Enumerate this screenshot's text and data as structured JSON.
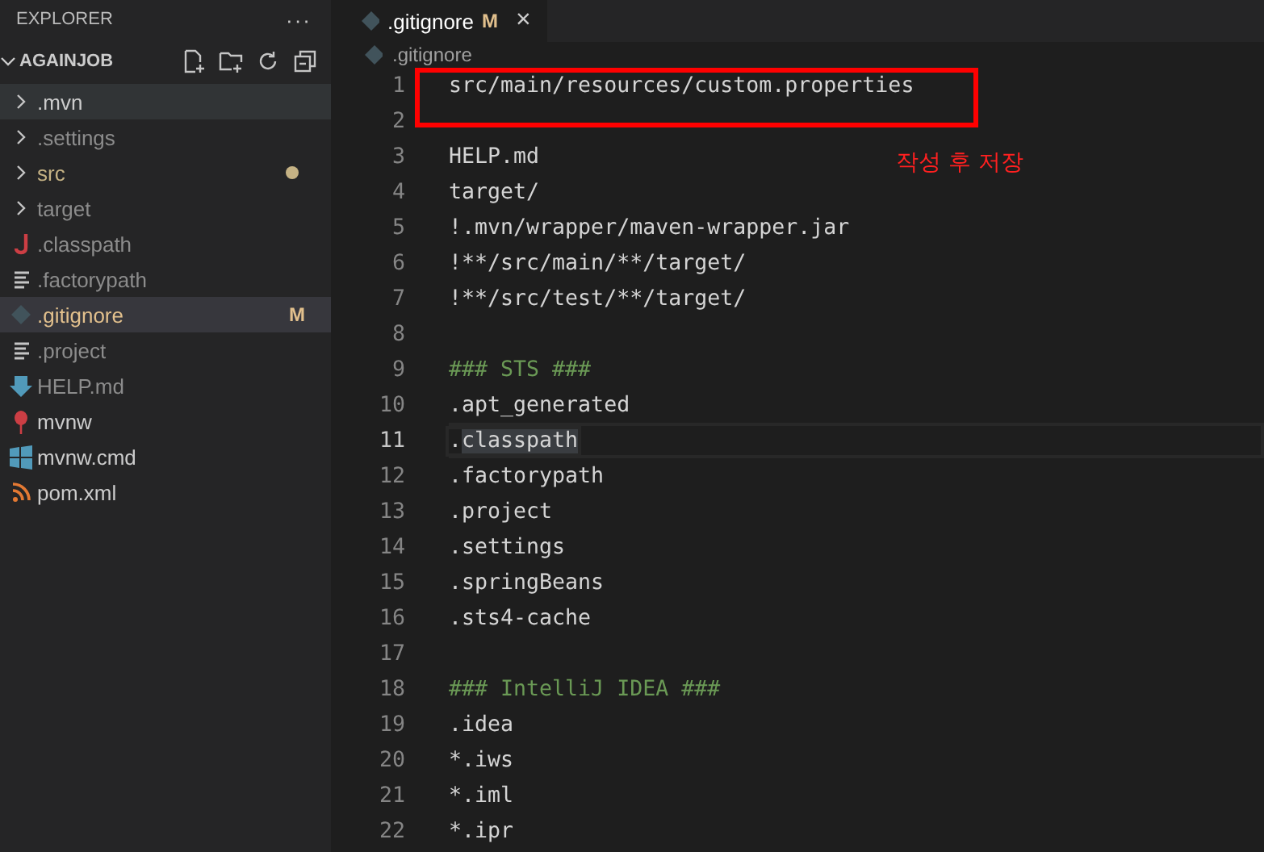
{
  "sidebar": {
    "title": "EXPLORER",
    "more": "···",
    "section": {
      "title": "AGAINJOB",
      "expanded": true
    },
    "items": [
      {
        "name": ".mvn",
        "kind": "folder",
        "ignored": false,
        "selected": false,
        "hovered": true
      },
      {
        "name": ".settings",
        "kind": "folder",
        "ignored": true,
        "selected": false,
        "hovered": false
      },
      {
        "name": "src",
        "kind": "folder",
        "ignored": false,
        "selected": false,
        "hovered": false,
        "modified_dot": true,
        "color": "#c5b284"
      },
      {
        "name": "target",
        "kind": "folder",
        "ignored": true,
        "selected": false,
        "hovered": false
      },
      {
        "name": ".classpath",
        "kind": "java",
        "ignored": true,
        "selected": false,
        "hovered": false
      },
      {
        "name": ".factorypath",
        "kind": "lines",
        "ignored": true,
        "selected": false,
        "hovered": false
      },
      {
        "name": ".gitignore",
        "kind": "git",
        "ignored": false,
        "selected": true,
        "hovered": false,
        "badge": "M",
        "color": "#e2c08d"
      },
      {
        "name": ".project",
        "kind": "lines",
        "ignored": true,
        "selected": false,
        "hovered": false
      },
      {
        "name": "HELP.md",
        "kind": "markdown",
        "ignored": true,
        "selected": false,
        "hovered": false
      },
      {
        "name": "mvnw",
        "kind": "pin",
        "ignored": false,
        "selected": false,
        "hovered": false
      },
      {
        "name": "mvnw.cmd",
        "kind": "windows",
        "ignored": false,
        "selected": false,
        "hovered": false
      },
      {
        "name": "pom.xml",
        "kind": "rss",
        "ignored": false,
        "selected": false,
        "hovered": false
      }
    ]
  },
  "tabs": [
    {
      "label": ".gitignore",
      "badge": "M",
      "close": "×",
      "selected": true
    }
  ],
  "breadcrumb": ".gitignore",
  "editor": {
    "lines": [
      {
        "number": "1",
        "kind": "plain",
        "segments": [
          {
            "text": "src/main/resources/custom.properties"
          }
        ]
      },
      {
        "number": "2",
        "kind": "blank"
      },
      {
        "number": "3",
        "kind": "plain",
        "segments": [
          {
            "text": "HELP.md"
          }
        ]
      },
      {
        "number": "4",
        "kind": "plain",
        "segments": [
          {
            "text": "target/"
          }
        ]
      },
      {
        "number": "5",
        "kind": "plain",
        "segments": [
          {
            "text": "!.mvn/wrapper/maven-wrapper.jar"
          }
        ]
      },
      {
        "number": "6",
        "kind": "plain",
        "segments": [
          {
            "text": "!**/src/main/**/target/"
          }
        ]
      },
      {
        "number": "7",
        "kind": "plain",
        "segments": [
          {
            "text": "!**/src/test/**/target/"
          }
        ]
      },
      {
        "number": "8",
        "kind": "blank"
      },
      {
        "number": "9",
        "kind": "comment",
        "segments": [
          {
            "text": "### STS ###"
          }
        ]
      },
      {
        "number": "10",
        "kind": "plain",
        "segments": [
          {
            "text": ".apt_generated"
          }
        ]
      },
      {
        "number": "11",
        "kind": "plain",
        "current": true,
        "segments": [
          {
            "text": "."
          },
          {
            "text": "classpath",
            "highlighted": true
          }
        ]
      },
      {
        "number": "12",
        "kind": "plain",
        "segments": [
          {
            "text": ".factorypath"
          }
        ]
      },
      {
        "number": "13",
        "kind": "plain",
        "segments": [
          {
            "text": ".project"
          }
        ]
      },
      {
        "number": "14",
        "kind": "plain",
        "segments": [
          {
            "text": ".settings"
          }
        ]
      },
      {
        "number": "15",
        "kind": "plain",
        "segments": [
          {
            "text": ".springBeans"
          }
        ]
      },
      {
        "number": "16",
        "kind": "plain",
        "segments": [
          {
            "text": ".sts4-cache"
          }
        ]
      },
      {
        "number": "17",
        "kind": "blank"
      },
      {
        "number": "18",
        "kind": "comment",
        "segments": [
          {
            "text": "### IntelliJ IDEA ###"
          }
        ]
      },
      {
        "number": "19",
        "kind": "plain",
        "segments": [
          {
            "text": ".idea"
          }
        ]
      },
      {
        "number": "20",
        "kind": "plain",
        "segments": [
          {
            "text": "*.iws"
          }
        ]
      },
      {
        "number": "21",
        "kind": "plain",
        "segments": [
          {
            "text": "*.iml"
          }
        ]
      },
      {
        "number": "22",
        "kind": "plain",
        "segments": [
          {
            "text": "*.ipr"
          }
        ]
      }
    ]
  },
  "annotation": {
    "text": "작성 후 저장"
  }
}
